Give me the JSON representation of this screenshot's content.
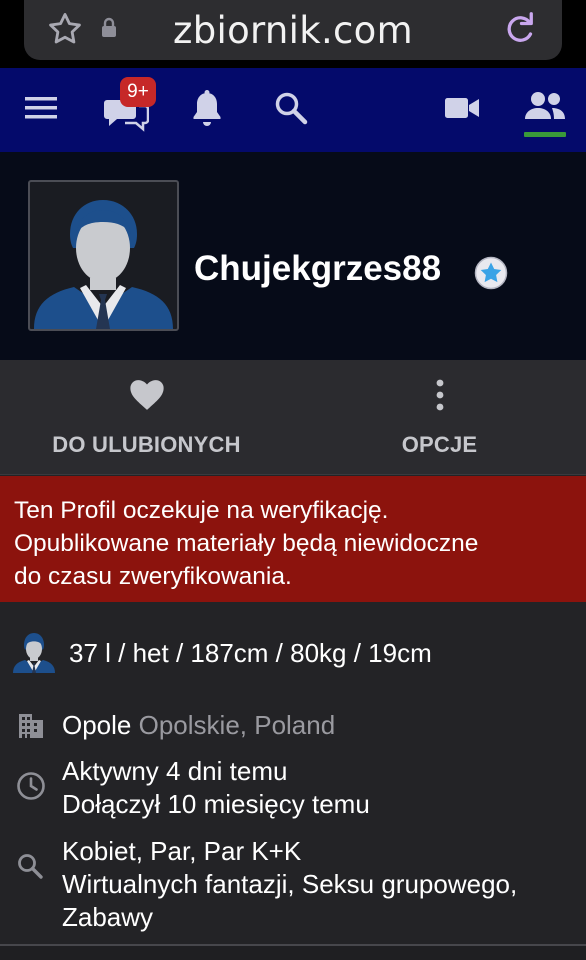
{
  "browser": {
    "domain": "zbiornik.com"
  },
  "nav": {
    "messages_badge": "9+"
  },
  "profile": {
    "username": "Chujekgrzes88"
  },
  "actions": {
    "favorite_label": "DO ULUBIONYCH",
    "options_label": "OPCJE"
  },
  "alert": {
    "line1": "Ten Profil oczekuje na weryfikację.",
    "line2": "Opublikowane materiały będą niewidoczne",
    "line3": "do czasu zweryfikowania."
  },
  "details": {
    "stats": "37 l / het / 187cm / 80kg / 19cm",
    "city": "Opole",
    "region": "Opolskie, Poland",
    "active": "Aktywny 4 dni temu",
    "joined": "Dołączył 10 miesięcy temu",
    "looking_for": "Kobiet, Par, Par K+K",
    "interests_line1": "Wirtualnych fantazji, Seksu grupowego,",
    "interests_line2": "Zabawy"
  },
  "colors": {
    "navbar": "#040a6b",
    "alert": "#8c130d",
    "badge": "#c62828",
    "active_underline": "#3a9a3a"
  },
  "icons": {
    "nav": [
      "menu-icon",
      "chat-icon",
      "bell-icon",
      "search-icon",
      "video-camera-icon",
      "people-icon"
    ],
    "actions": [
      "heart-icon",
      "more-vertical-icon"
    ],
    "details": [
      "avatar-icon",
      "building-icon",
      "clock-icon",
      "search-icon"
    ]
  }
}
